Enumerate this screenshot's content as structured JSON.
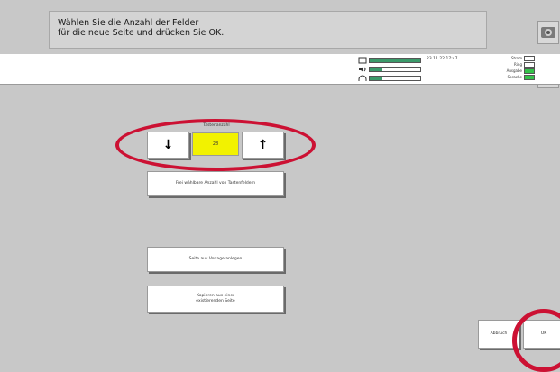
{
  "instruction": {
    "line1": "Wählen Sie die Anzahl der Felder",
    "line2": "für die neue Seite und drücken Sie OK."
  },
  "status": {
    "datetime": "23.11.22 17:47",
    "meters": [
      {
        "icon": "microphone-icon",
        "level": 1.0
      },
      {
        "icon": "speaker-icon",
        "level": 0.25
      },
      {
        "icon": "headphones-icon",
        "level": 0.25
      }
    ],
    "indicators": [
      {
        "label": "Strom",
        "active": false
      },
      {
        "label": "Ring",
        "active": false
      },
      {
        "label": "Ausgabe",
        "active": true
      },
      {
        "label": "Sprache",
        "active": true
      }
    ]
  },
  "counter": {
    "label": "Tastenanzahl",
    "value": "28"
  },
  "buttons": {
    "free_selection": "Frei wählbare Anzahl von Tastenfeldern",
    "template_page": "Seite aus Vorlage anlegen",
    "copy_page_1": "Kopieren aus einer",
    "copy_page_2": "existierenden Seite",
    "cancel": "Abbruch",
    "ok": "OK"
  },
  "colors": {
    "highlight": "#cc1133",
    "counter_bg": "#f2f200",
    "meter_fill": "#3b9a6a",
    "led_active": "#34c24a"
  }
}
